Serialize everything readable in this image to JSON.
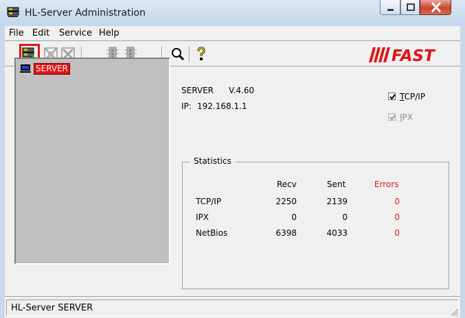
{
  "window": {
    "title": "HL-Server Administration",
    "app_icon": "server-app-icon",
    "controls": [
      "minimize-icon",
      "maximize-icon",
      "close-icon"
    ]
  },
  "menu": {
    "items": [
      "File",
      "Edit",
      "Service",
      "Help"
    ]
  },
  "toolbar": {
    "buttons": [
      {
        "icon": "add-server-icon",
        "state": "selected"
      },
      {
        "icon": "server-disabled-icon",
        "state": "disabled"
      },
      {
        "icon": "remove-server-icon",
        "state": "disabled"
      },
      {
        "icon": "traffic-light-icon",
        "state": "disabled"
      },
      {
        "icon": "traffic-light-icon",
        "state": "disabled"
      },
      {
        "icon": "search-icon",
        "state": "enabled"
      },
      {
        "icon": "help-question-icon",
        "state": "enabled"
      }
    ],
    "logo": "FAST",
    "brand_color": "#e01414"
  },
  "tree": {
    "items": [
      {
        "label": "SERVER",
        "icon": "computer-icon",
        "selected": true
      }
    ]
  },
  "server_info": {
    "name": "SERVER",
    "version": "V.4.60",
    "ip_label": "IP:",
    "ip": "192.168.1.1"
  },
  "protocols": {
    "tcpip": {
      "label_accel": "T",
      "label_rest": "CP/IP",
      "checked": true,
      "enabled": true
    },
    "ipx": {
      "label_accel": "I",
      "label_rest": "PX",
      "checked": true,
      "enabled": false
    }
  },
  "statistics": {
    "title": "Statistics",
    "headers": [
      "Recv",
      "Sent",
      "Errors"
    ],
    "rows": [
      {
        "name": "TCP/IP",
        "recv": "2250",
        "sent": "2139",
        "errors": "0"
      },
      {
        "name": "IPX",
        "recv": "0",
        "sent": "0",
        "errors": "0"
      },
      {
        "name": "NetBios",
        "recv": "6398",
        "sent": "4033",
        "errors": "0"
      }
    ],
    "error_color": "#e01414"
  },
  "status": {
    "text": "HL-Server SERVER"
  }
}
